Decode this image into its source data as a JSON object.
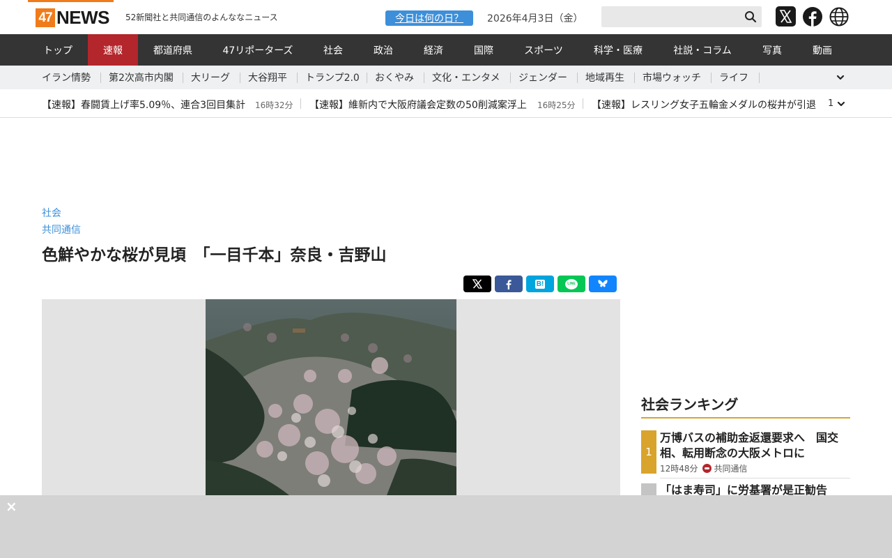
{
  "header": {
    "logo_num": "47",
    "logo_word": "NEWS",
    "tagline": "52新聞社と共同通信のよんななニュース",
    "today_button": "今日は何の日？",
    "date": "2026年4月3日（金）",
    "search_placeholder": ""
  },
  "main_nav": [
    {
      "label": "トップ"
    },
    {
      "label": "速報",
      "active": true
    },
    {
      "label": "都道府県"
    },
    {
      "label": "47リポーターズ"
    },
    {
      "label": "社会"
    },
    {
      "label": "政治"
    },
    {
      "label": "経済"
    },
    {
      "label": "国際"
    },
    {
      "label": "スポーツ"
    },
    {
      "label": "科学・医療"
    },
    {
      "label": "社説・コラム"
    },
    {
      "label": "写真"
    },
    {
      "label": "動画"
    }
  ],
  "sub_nav": [
    {
      "label": "イラン情勢"
    },
    {
      "label": "第2次高市内閣"
    },
    {
      "label": "大リーグ"
    },
    {
      "label": "大谷翔平"
    },
    {
      "label": "トランプ2.0"
    },
    {
      "label": "おくやみ"
    },
    {
      "label": "文化・エンタメ"
    },
    {
      "label": "ジェンダー"
    },
    {
      "label": "地域再生"
    },
    {
      "label": "市場ウォッチ"
    },
    {
      "label": "ライフ"
    }
  ],
  "ticker": {
    "items": [
      {
        "text": "【速報】春闘賃上げ率5.09％、連合3回目集計",
        "time": "16時32分"
      },
      {
        "text": "【速報】維新内で大阪府議会定数の50削減案浮上",
        "time": "16時25分"
      },
      {
        "text": "【速報】レスリング女子五輪金メダルの桜井が引退",
        "time": ""
      }
    ],
    "count": "1"
  },
  "article": {
    "category": "社会",
    "source": "共同通信",
    "headline": "色鮮やかな桜が見頃　「一目千本」奈良・吉野山"
  },
  "share": {
    "x": "x-icon",
    "facebook": "facebook-icon",
    "hatena": "B!",
    "line": "LINE",
    "bluesky": "bluesky-icon"
  },
  "ranking": {
    "title": "社会ランキング",
    "items": [
      {
        "rank": "1",
        "text": "万博バスの補助金返還要求へ　国交相、転用断念の大阪メトロに",
        "time": "12時48分",
        "source": "共同通信"
      },
      {
        "rank": "",
        "text": "「はま寿司」に労基署が是正勧告"
      }
    ]
  },
  "colors": {
    "accent_orange": "#f07b1a",
    "nav_bg": "#343434",
    "nav_active": "#b3262b",
    "link_blue": "#3d8fd9",
    "rank_gold": "#d9a42c"
  },
  "overlay": {
    "close": "×"
  }
}
